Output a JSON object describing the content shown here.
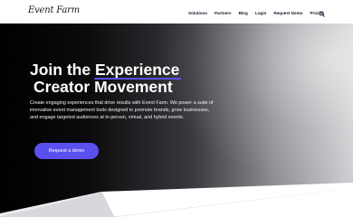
{
  "header": {
    "logo_text": "Event Farm",
    "logo_subtext": "",
    "nav": [
      {
        "label": "Solutions"
      },
      {
        "label": "Partners"
      },
      {
        "label": "Blog"
      },
      {
        "label": "Login"
      },
      {
        "label": "Request Demo"
      },
      {
        "label": "Pricing"
      }
    ],
    "search_icon": "search-icon"
  },
  "hero": {
    "title_line1_prefix": "Join the",
    "title_line1_highlight": "Experience",
    "title_line2": "Creator Movement",
    "body": "Create engaging experiences that drive results with Event Farm. We power a suite of innovative event management tools designed to promote brands, grow businesses, and engage targeted audiences at in-person, virtual, and hybrid events.",
    "cta_button": "Request a demo",
    "cta_link": ""
  },
  "colors": {
    "accent": "#5a50ef",
    "nav_text": "#1b1b2f",
    "hero_text": "#ffffff"
  }
}
